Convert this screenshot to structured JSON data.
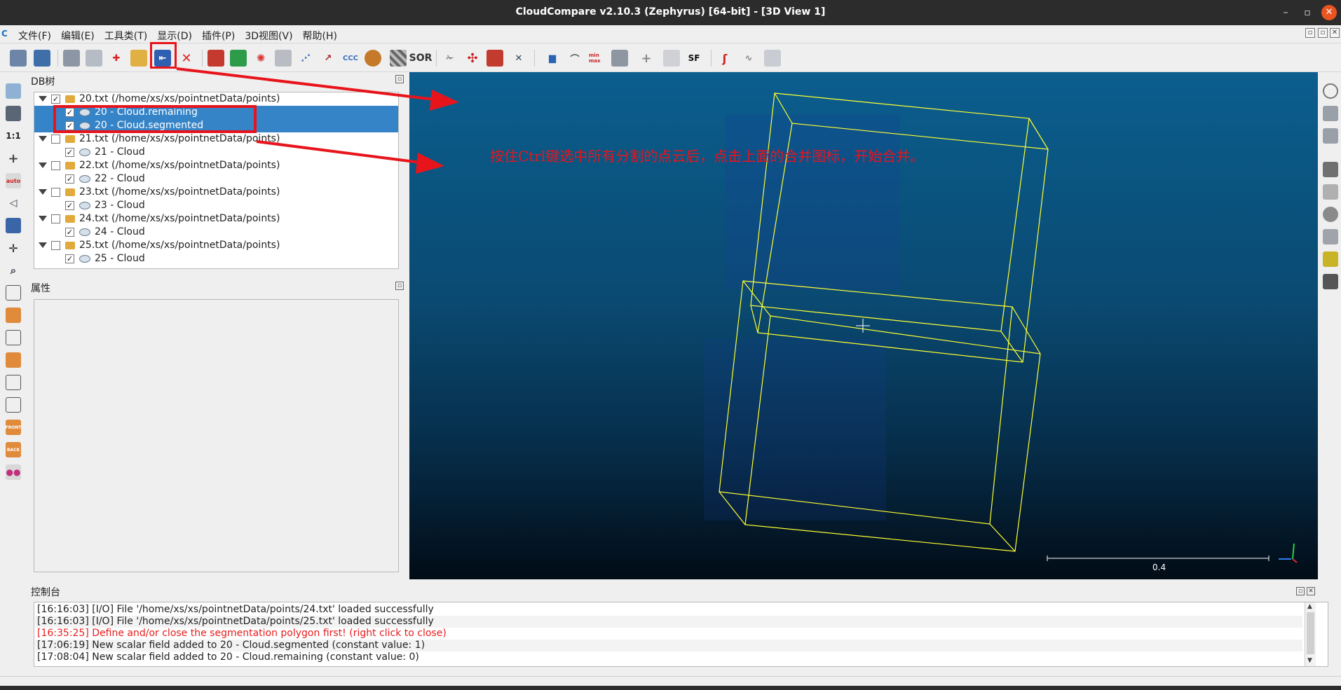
{
  "window": {
    "title": "CloudCompare v2.10.3 (Zephyrus) [64-bit] - [3D View 1]",
    "minimize": "–",
    "maximize": "▫",
    "close": "✕"
  },
  "menubar": {
    "logo": "C",
    "items": [
      "文件(F)",
      "编辑(E)",
      "工具类(T)",
      "显示(D)",
      "插件(P)",
      "3D视图(V)",
      "帮助(H)"
    ]
  },
  "toolbar": {
    "labels": {
      "cc": "CCC",
      "sor": "SOR",
      "sf": "SF",
      "minmax": "min max"
    }
  },
  "left_toolbar": {
    "one_to_one": "1:1",
    "auto": "auto",
    "front": "FRONT",
    "back": "BACK"
  },
  "db_tree": {
    "title": "DB树",
    "rows": [
      {
        "label": "20.txt (/home/xs/xs/pointnetData/points)",
        "kind": "folder",
        "checked": "✓"
      },
      {
        "label": "20 - Cloud.remaining",
        "kind": "cloud",
        "checked": "✓",
        "selected": true
      },
      {
        "label": "20 - Cloud.segmented",
        "kind": "cloud",
        "checked": "✓",
        "selected": true
      },
      {
        "label": "21.txt (/home/xs/xs/pointnetData/points)",
        "kind": "folder",
        "checked": ""
      },
      {
        "label": "21 - Cloud",
        "kind": "cloud",
        "checked": "✓"
      },
      {
        "label": "22.txt (/home/xs/xs/pointnetData/points)",
        "kind": "folder",
        "checked": ""
      },
      {
        "label": "22 - Cloud",
        "kind": "cloud",
        "checked": "✓"
      },
      {
        "label": "23.txt (/home/xs/xs/pointnetData/points)",
        "kind": "folder",
        "checked": ""
      },
      {
        "label": "23 - Cloud",
        "kind": "cloud",
        "checked": "✓"
      },
      {
        "label": "24.txt (/home/xs/xs/pointnetData/points)",
        "kind": "folder",
        "checked": ""
      },
      {
        "label": "24 - Cloud",
        "kind": "cloud",
        "checked": "✓"
      },
      {
        "label": "25.txt (/home/xs/xs/pointnetData/points)",
        "kind": "folder",
        "checked": ""
      },
      {
        "label": "25 - Cloud",
        "kind": "cloud",
        "checked": "✓"
      }
    ]
  },
  "properties": {
    "title": "属性"
  },
  "view3d": {
    "annotation": "按住Ctrl键选中所有分割的点云后，点击上面的合并图标，开始合并。",
    "scale_label": "0.4"
  },
  "console": {
    "title": "控制台",
    "lines": [
      {
        "text": "[16:16:03] [I/O] File '/home/xs/xs/pointnetData/points/24.txt' loaded successfully",
        "type": "info"
      },
      {
        "text": "[16:16:03] [I/O] File '/home/xs/xs/pointnetData/points/25.txt' loaded successfully",
        "type": "info"
      },
      {
        "text": "[16:35:25] Define and/or close the segmentation polygon first! (right click to close)",
        "type": "error"
      },
      {
        "text": "[17:06:19] New scalar field added to 20 - Cloud.segmented (constant value: 1)",
        "type": "info"
      },
      {
        "text": "[17:08:04] New scalar field added to 20 - Cloud.remaining (constant value: 0)",
        "type": "info"
      }
    ]
  },
  "colors": {
    "annotation_red": "#e8141c",
    "selection_blue": "#3584c8",
    "bbox_yellow": "#ffff33",
    "error_red": "#e81c1c"
  }
}
